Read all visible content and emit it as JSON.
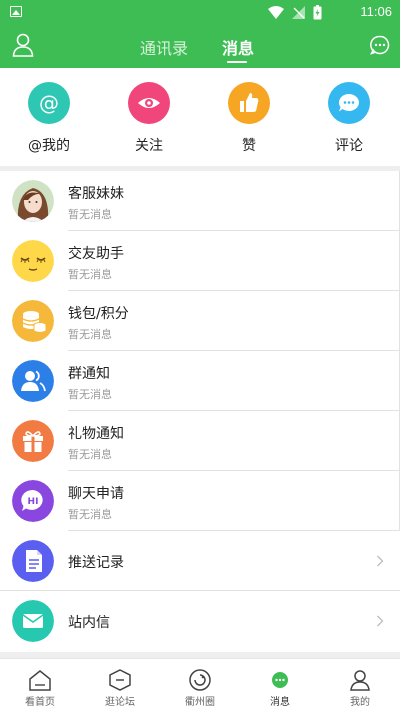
{
  "status_bar": {
    "time": "11:06"
  },
  "header": {
    "tabs": [
      {
        "label": "通讯录",
        "active": false
      },
      {
        "label": "消息",
        "active": true
      }
    ]
  },
  "quick_actions": [
    {
      "label": "@我的",
      "icon": "at-icon",
      "color": "#2ec7b3"
    },
    {
      "label": "关注",
      "icon": "eye-icon",
      "color": "#f0467c"
    },
    {
      "label": "赞",
      "icon": "thumbs-up-icon",
      "color": "#f6a623"
    },
    {
      "label": "评论",
      "icon": "comment-icon",
      "color": "#35b8ef"
    }
  ],
  "messages": [
    {
      "title": "客服妹妹",
      "subtitle": "暂无消息",
      "icon": "avatar-photo"
    },
    {
      "title": "交友助手",
      "subtitle": "暂无消息",
      "icon": "emoji-face-icon"
    },
    {
      "title": "钱包/积分",
      "subtitle": "暂无消息",
      "icon": "coins-icon"
    },
    {
      "title": "群通知",
      "subtitle": "暂无消息",
      "icon": "group-icon"
    },
    {
      "title": "礼物通知",
      "subtitle": "暂无消息",
      "icon": "gift-icon"
    },
    {
      "title": "聊天申请",
      "subtitle": "暂无消息",
      "icon": "hi-bubble-icon"
    }
  ],
  "links": [
    {
      "title": "推送记录",
      "icon": "document-icon",
      "color": "#5b5ff0"
    },
    {
      "title": "站内信",
      "icon": "mail-icon",
      "color": "#26c9b0"
    }
  ],
  "tabbar": [
    {
      "label": "看首页",
      "icon": "home-icon",
      "active": false
    },
    {
      "label": "逛论坛",
      "icon": "forum-icon",
      "active": false
    },
    {
      "label": "衢州圈",
      "icon": "circle-icon",
      "active": false
    },
    {
      "label": "消息",
      "icon": "message-icon",
      "active": true
    },
    {
      "label": "我的",
      "icon": "profile-icon",
      "active": false
    }
  ]
}
